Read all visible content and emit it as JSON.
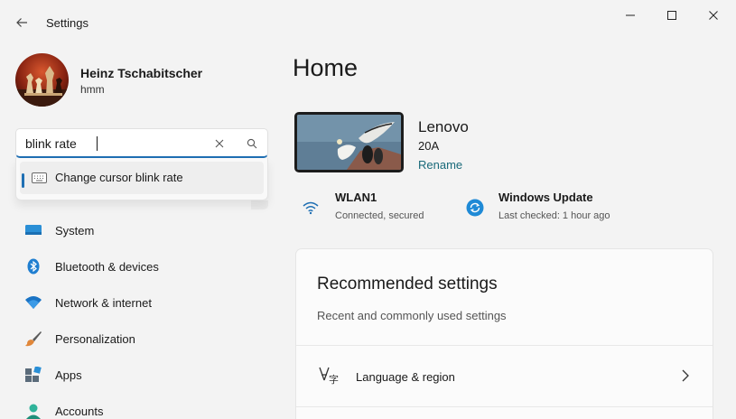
{
  "window": {
    "title": "Settings"
  },
  "user": {
    "name": "Heinz Tschabitscher",
    "subtitle": "hmm"
  },
  "search": {
    "value": "blink rate",
    "suggestion": "Change cursor blink rate"
  },
  "sidebar": {
    "items": [
      {
        "label": "System",
        "icon": "system-icon"
      },
      {
        "label": "Bluetooth & devices",
        "icon": "bluetooth-icon"
      },
      {
        "label": "Network & internet",
        "icon": "wifi-icon"
      },
      {
        "label": "Personalization",
        "icon": "brush-icon"
      },
      {
        "label": "Apps",
        "icon": "apps-icon"
      },
      {
        "label": "Accounts",
        "icon": "accounts-icon"
      }
    ]
  },
  "main": {
    "title": "Home",
    "device": {
      "name": "Lenovo",
      "model": "20A",
      "rename": "Rename"
    },
    "status": {
      "network_title": "WLAN1",
      "network_sub": "Connected, secured",
      "update_title": "Windows Update",
      "update_sub": "Last checked: 1 hour ago"
    },
    "recommended": {
      "title": "Recommended settings",
      "subtitle": "Recent and commonly used settings",
      "items": [
        {
          "label": "Language & region",
          "icon": "language-icon"
        }
      ]
    }
  },
  "colors": {
    "accent": "#1f6fb3",
    "link": "#1a6a7a",
    "background": "#f3f3f3"
  }
}
